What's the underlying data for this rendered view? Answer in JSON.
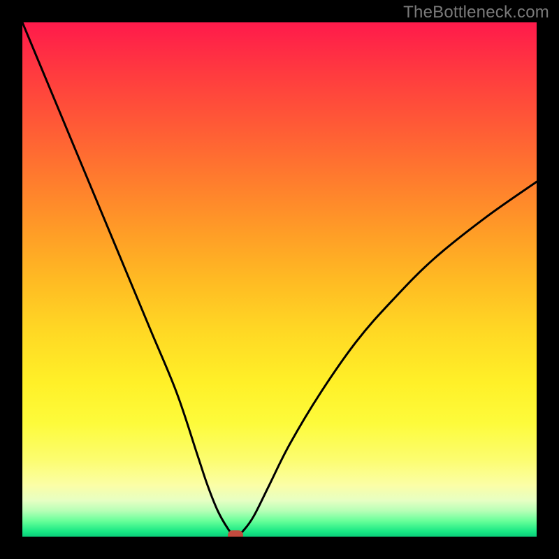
{
  "watermark": "TheBottleneck.com",
  "chart_data": {
    "type": "line",
    "title": "",
    "xlabel": "",
    "ylabel": "",
    "xlim": [
      0,
      100
    ],
    "ylim": [
      0,
      100
    ],
    "x": [
      0,
      5,
      10,
      15,
      20,
      25,
      30,
      34,
      36,
      38,
      40,
      41,
      42,
      43,
      45,
      48,
      52,
      58,
      65,
      72,
      80,
      90,
      100
    ],
    "values": [
      100,
      88,
      76,
      64,
      52,
      40,
      28,
      16,
      10,
      5,
      1.5,
      0.5,
      0.5,
      1.2,
      4,
      10,
      18,
      28,
      38,
      46,
      54,
      62,
      69
    ],
    "marker": {
      "x": 41.5,
      "y": 0
    },
    "gradient_colors": {
      "top": "#ff1a4b",
      "mid": "#ffd824",
      "bottom": "#0acc7a"
    }
  }
}
